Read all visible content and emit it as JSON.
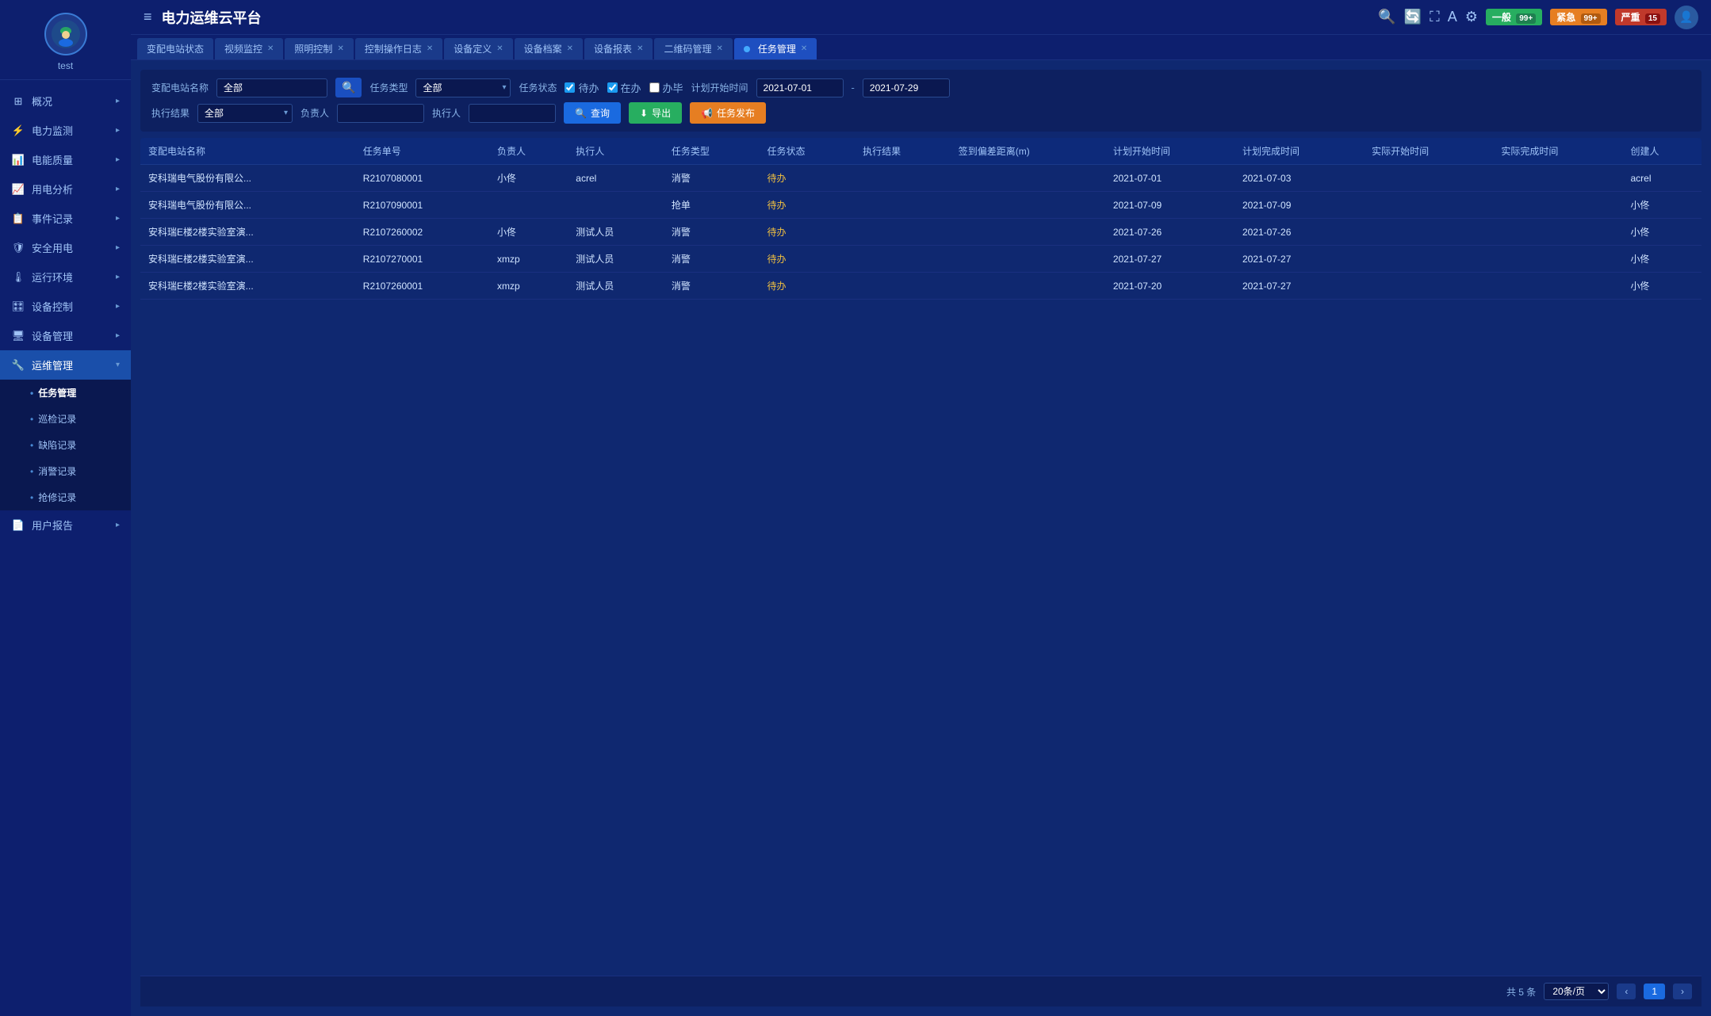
{
  "app": {
    "title": "电力运维云平台"
  },
  "sidebar": {
    "username": "test",
    "items": [
      {
        "id": "overview",
        "label": "概况",
        "icon": "grid-icon",
        "hasArrow": true
      },
      {
        "id": "power-monitor",
        "label": "电力监测",
        "icon": "bolt-icon",
        "hasArrow": true
      },
      {
        "id": "energy-quality",
        "label": "电能质量",
        "icon": "chart-icon",
        "hasArrow": true
      },
      {
        "id": "power-analysis",
        "label": "用电分析",
        "icon": "analysis-icon",
        "hasArrow": true
      },
      {
        "id": "event-record",
        "label": "事件记录",
        "icon": "event-icon",
        "hasArrow": true
      },
      {
        "id": "safe-power",
        "label": "安全用电",
        "icon": "shield-icon",
        "hasArrow": true
      },
      {
        "id": "run-env",
        "label": "运行环境",
        "icon": "env-icon",
        "hasArrow": true
      },
      {
        "id": "device-control",
        "label": "设备控制",
        "icon": "control-icon",
        "hasArrow": true
      },
      {
        "id": "device-mgmt",
        "label": "设备管理",
        "icon": "device-icon",
        "hasArrow": true
      },
      {
        "id": "ops-mgmt",
        "label": "运维管理",
        "icon": "ops-icon",
        "hasArrow": true,
        "active": true
      },
      {
        "id": "user-report",
        "label": "用户报告",
        "icon": "report-icon",
        "hasArrow": true
      }
    ],
    "submenu_ops": [
      {
        "id": "task-mgmt",
        "label": "任务管理",
        "active": true
      },
      {
        "id": "patrol-record",
        "label": "巡检记录"
      },
      {
        "id": "defect-record",
        "label": "缺陷记录"
      },
      {
        "id": "alarm-record",
        "label": "消警记录"
      },
      {
        "id": "emergency-record",
        "label": "抢修记录"
      }
    ]
  },
  "topbar": {
    "menu_icon": "≡",
    "title": "电力运维云平台",
    "badge_normal": "一般",
    "badge_normal_count": "99+",
    "badge_high": "紧急",
    "badge_high_count": "99+",
    "badge_critical": "严重",
    "badge_critical_count": "15"
  },
  "tabs": [
    {
      "label": "变配电站状态",
      "closable": false,
      "active": false
    },
    {
      "label": "视频监控",
      "closable": true,
      "active": false
    },
    {
      "label": "照明控制",
      "closable": true,
      "active": false
    },
    {
      "label": "控制操作日志",
      "closable": true,
      "active": false
    },
    {
      "label": "设备定义",
      "closable": true,
      "active": false
    },
    {
      "label": "设备档案",
      "closable": true,
      "active": false
    },
    {
      "label": "设备报表",
      "closable": true,
      "active": false
    },
    {
      "label": "二维码管理",
      "closable": true,
      "active": false
    },
    {
      "label": "任务管理",
      "closable": true,
      "active": true
    }
  ],
  "filters": {
    "station_label": "变配电站名称",
    "station_value": "全部",
    "task_type_label": "任务类型",
    "task_type_value": "全部",
    "task_status_label": "任务状态",
    "pending_label": "待办",
    "ongoing_label": "在办",
    "done_label": "办毕",
    "plan_start_label": "计划开始时间",
    "plan_start_from": "2021-07-01",
    "plan_start_to": "2021-07-29",
    "exec_result_label": "执行结果",
    "exec_result_value": "全部",
    "responsible_label": "负责人",
    "responsible_value": "",
    "executor_label": "执行人",
    "executor_value": "",
    "query_btn": "查询",
    "export_btn": "导出",
    "publish_btn": "任务发布"
  },
  "table": {
    "columns": [
      "变配电站名称",
      "任务单号",
      "负责人",
      "执行人",
      "任务类型",
      "任务状态",
      "执行结果",
      "签到偏差距离(m)",
      "计划开始时间",
      "计划完成时间",
      "实际开始时间",
      "实际完成时间",
      "创建人"
    ],
    "rows": [
      {
        "station": "安科瑞电气股份有限公...",
        "task_no": "R2107080001",
        "responsible": "小佟",
        "executor": "acrel",
        "task_type": "消警",
        "status": "待办",
        "exec_result": "",
        "deviation": "",
        "plan_start": "2021-07-01",
        "plan_end": "2021-07-03",
        "actual_start": "",
        "actual_end": "",
        "creator": "acrel",
        "extra": "2021-"
      },
      {
        "station": "安科瑞电气股份有限公...",
        "task_no": "R2107090001",
        "responsible": "",
        "executor": "",
        "task_type": "抢单",
        "status": "待办",
        "exec_result": "",
        "deviation": "",
        "plan_start": "2021-07-09",
        "plan_end": "2021-07-09",
        "actual_start": "",
        "actual_end": "",
        "creator": "小佟",
        "extra": "2021-"
      },
      {
        "station": "安科瑞E楼2楼实验室演...",
        "task_no": "R2107260002",
        "responsible": "小佟",
        "executor": "测试人员",
        "task_type": "消警",
        "status": "待办",
        "exec_result": "",
        "deviation": "",
        "plan_start": "2021-07-26",
        "plan_end": "2021-07-26",
        "actual_start": "",
        "actual_end": "",
        "creator": "小佟",
        "extra": "2021-"
      },
      {
        "station": "安科瑞E楼2楼实验室演...",
        "task_no": "R2107270001",
        "responsible": "xmzp",
        "executor": "测试人员",
        "task_type": "消警",
        "status": "待办",
        "exec_result": "",
        "deviation": "",
        "plan_start": "2021-07-27",
        "plan_end": "2021-07-27",
        "actual_start": "",
        "actual_end": "",
        "creator": "小佟",
        "extra": "2021-"
      },
      {
        "station": "安科瑞E楼2楼实验室演...",
        "task_no": "R2107260001",
        "responsible": "xmzp",
        "executor": "测试人员",
        "task_type": "消警",
        "status": "待办",
        "exec_result": "",
        "deviation": "",
        "plan_start": "2021-07-20",
        "plan_end": "2021-07-27",
        "actual_start": "",
        "actual_end": "",
        "creator": "小佟",
        "extra": "2021-"
      }
    ]
  },
  "pagination": {
    "total_label": "共 5 条",
    "page_size_label": "20条/页",
    "current_page": "1",
    "prev_btn": "‹",
    "next_btn": "›"
  }
}
